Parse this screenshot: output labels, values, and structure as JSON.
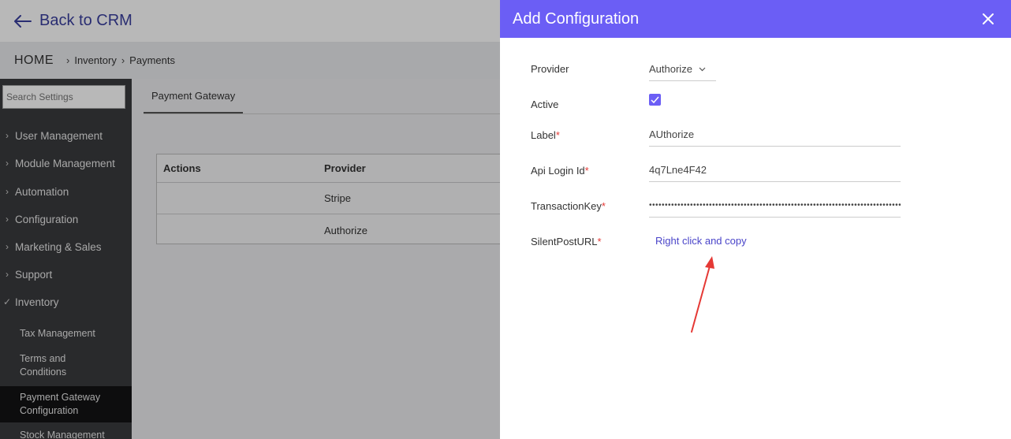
{
  "topbar": {
    "back_label": "Back to CRM"
  },
  "breadcrumb": {
    "home": "HOME",
    "items": [
      "Inventory",
      "Payments"
    ]
  },
  "sidebar": {
    "search_placeholder": "Search Settings",
    "items": [
      {
        "label": "User Management"
      },
      {
        "label": "Module Management"
      },
      {
        "label": "Automation"
      },
      {
        "label": "Configuration"
      },
      {
        "label": "Marketing & Sales"
      },
      {
        "label": "Support"
      },
      {
        "label": "Inventory"
      }
    ],
    "sub_items": [
      {
        "label": "Tax Management"
      },
      {
        "label": "Terms and Conditions"
      },
      {
        "label": "Payment Gateway Configuration"
      },
      {
        "label": "Stock Management"
      }
    ]
  },
  "main": {
    "tab": "Payment Gateway",
    "table": {
      "headers": [
        "Actions",
        "Provider"
      ],
      "rows": [
        {
          "actions": "",
          "provider": "Stripe"
        },
        {
          "actions": "",
          "provider": "Authorize"
        }
      ]
    }
  },
  "modal": {
    "title": "Add Configuration",
    "fields": {
      "provider_label": "Provider",
      "provider_value": "Authorize",
      "active_label": "Active",
      "label_label": "Label",
      "label_value": "AUthorize",
      "api_login_label": "Api Login Id",
      "api_login_value": "4q7Lne4F42",
      "transaction_key_label": "TransactionKey",
      "transaction_key_value": "••••••••••••••••••••••••••••••••••••••••••••••••••••••••••••••••••••••••••••••••",
      "silent_post_label": "SilentPostURL",
      "silent_post_link": "Right click and copy",
      "required_mark": "*"
    }
  },
  "colors": {
    "accent": "#6b5ef5",
    "link": "#4a45c9",
    "required": "#e53935",
    "annotation_arrow": "#e53935"
  }
}
